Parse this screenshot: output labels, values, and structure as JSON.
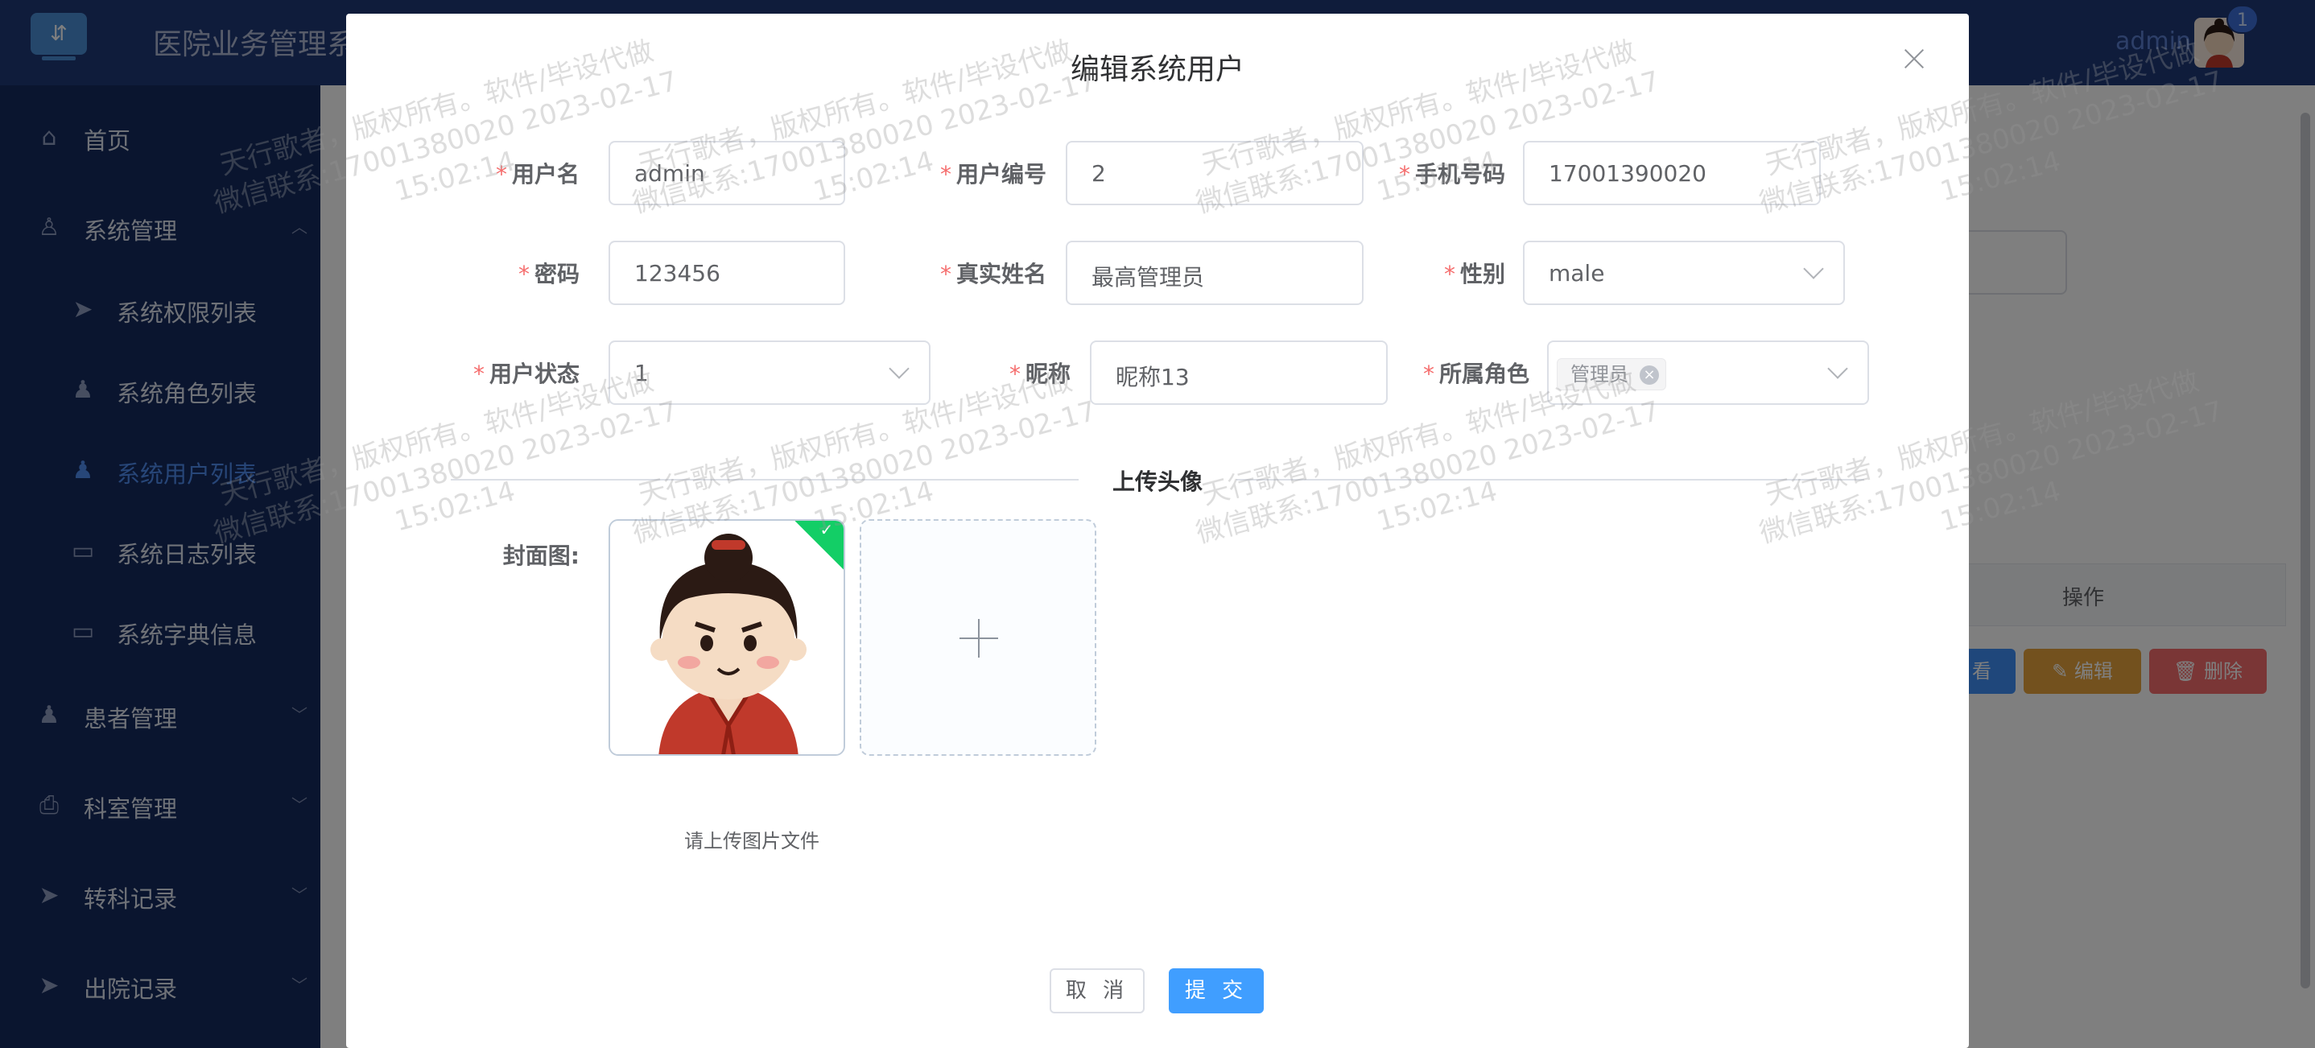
{
  "app": {
    "title": "医院业务管理系统",
    "user_name": "admin",
    "notification_count": "1"
  },
  "sidebar": {
    "items": [
      {
        "label": "首页",
        "icon": "home-icon"
      },
      {
        "label": "系统管理",
        "icon": "user-outline-icon",
        "expanded": true
      },
      {
        "label": "系统权限列表",
        "icon": "paper-plane-icon"
      },
      {
        "label": "系统角色列表",
        "icon": "user-filled-icon"
      },
      {
        "label": "系统用户列表",
        "icon": "user-filled-icon",
        "active": true
      },
      {
        "label": "系统日志列表",
        "icon": "message-icon"
      },
      {
        "label": "系统字典信息",
        "icon": "card-icon"
      },
      {
        "label": "患者管理",
        "icon": "user-filled-icon"
      },
      {
        "label": "科室管理",
        "icon": "printer-icon"
      },
      {
        "label": "转科记录",
        "icon": "paper-plane-icon"
      },
      {
        "label": "出院记录",
        "icon": "paper-plane-icon"
      }
    ]
  },
  "table": {
    "operation_header": "操作",
    "view_label": "看",
    "edit_label": "编辑",
    "delete_label": "删除"
  },
  "dialog": {
    "title": "编辑系统用户",
    "fields": {
      "username": {
        "label": "用户名",
        "value": "admin"
      },
      "user_no": {
        "label": "用户编号",
        "value": "2"
      },
      "phone": {
        "label": "手机号码",
        "value": "17001390020"
      },
      "password": {
        "label": "密码",
        "value": "123456"
      },
      "real_name": {
        "label": "真实姓名",
        "value": "最高管理员"
      },
      "gender": {
        "label": "性别",
        "value": "male"
      },
      "status": {
        "label": "用户状态",
        "value": "1"
      },
      "nickname": {
        "label": "昵称",
        "value": "昵称13"
      },
      "role": {
        "label": "所属角色",
        "tag": "管理员"
      }
    },
    "required_mark": "*",
    "divider": "上传头像",
    "cover_label": "封面图:",
    "upload_tip": "请上传图片文件",
    "cancel": "取 消",
    "submit": "提 交"
  },
  "watermark": {
    "line1": "天行歌者，版权所有。软件/毕设代做",
    "line2": "微信联系:17001380020 2023-02-17",
    "line3": "15:02:14"
  },
  "colors": {
    "topbar": "#1f3877",
    "sidebar": "#152a5e",
    "active_menu": "#4f8cf0",
    "primary": "#409eff",
    "required": "#f56c6c",
    "edit": "#e6a23c",
    "delete": "#f56c6c",
    "success": "#13ce66"
  }
}
